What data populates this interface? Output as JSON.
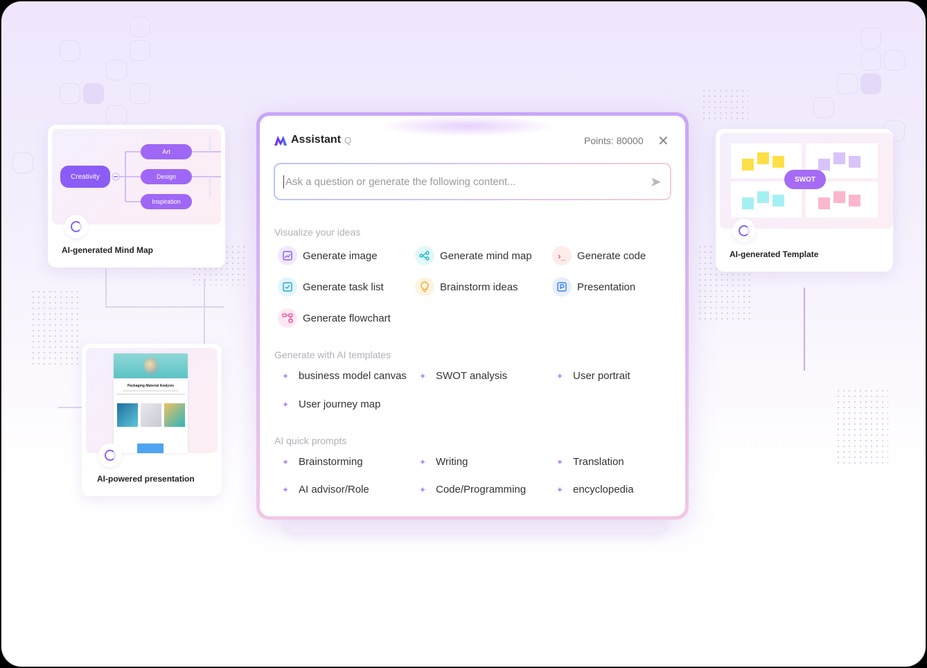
{
  "colors": {
    "accent": "#8b5cf6",
    "border_gradient_top": "#c8a6f8",
    "border_gradient_bottom": "#f0c8e6"
  },
  "cards": {
    "mindmap": {
      "label": "AI-generated Mind Map",
      "root": "Creativity",
      "branches": [
        "Art",
        "Design",
        "Inspiration"
      ]
    },
    "template": {
      "label": "AI-generated Template",
      "center": "SWOT"
    },
    "presentation": {
      "label": "AI-powered presentation",
      "slide_title": "Packaging Material Analysis"
    }
  },
  "assistant": {
    "title": "Assistant",
    "shortcut": "Q",
    "points": "Points: 80000",
    "close_icon": "close-icon",
    "search": {
      "placeholder": "Ask a question or generate the following content...",
      "send_icon": "send-icon"
    },
    "sections": {
      "visualize": {
        "title": "Visualize your ideas",
        "items": [
          {
            "label": "Generate image",
            "icon": "image-icon",
            "color": "#8b5cf6"
          },
          {
            "label": "Generate mind map",
            "icon": "mindmap-icon",
            "color": "#14b8c9"
          },
          {
            "label": "Generate code",
            "icon": "code-icon",
            "color": "#f0645a"
          },
          {
            "label": "Generate task list",
            "icon": "checkbox-icon",
            "color": "#22a8d8"
          },
          {
            "label": "Brainstorm ideas",
            "icon": "lightbulb-icon",
            "color": "#f5a623"
          },
          {
            "label": "Presentation",
            "icon": "presentation-icon",
            "color": "#3b82f6"
          },
          {
            "label": "Generate flowchart",
            "icon": "flowchart-icon",
            "color": "#ec4899"
          }
        ]
      },
      "templates": {
        "title": "Generate with AI templates",
        "items": [
          "business model canvas",
          "SWOT analysis",
          "User portrait",
          "User journey map"
        ]
      },
      "prompts": {
        "title": "AI quick prompts",
        "items": [
          "Brainstorming",
          "Writing",
          "Translation",
          "AI advisor/Role",
          "Code/Programming",
          "encyclopedia"
        ]
      }
    }
  }
}
